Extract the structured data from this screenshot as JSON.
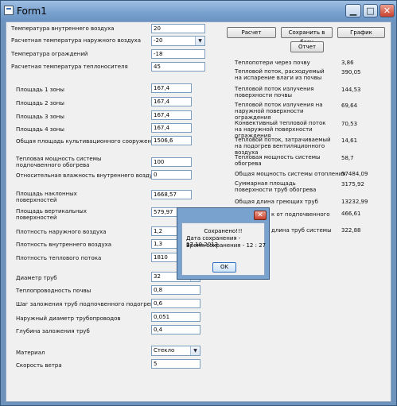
{
  "window": {
    "title": "Form1",
    "minimize_glyph": "▁",
    "maximize_glyph": "□",
    "close_glyph": "✕"
  },
  "toolbar": {
    "calc_label": "Расчет",
    "save_db_label": "Сохранить в базу",
    "graph_label": "График",
    "report_label": "Отчет"
  },
  "inputs": {
    "inner_temp": {
      "label": "Температура внутреннего воздуха",
      "value": "20"
    },
    "outer_temp": {
      "label": "Расчетная температура наружного воздуха",
      "value": "-20"
    },
    "envelope_temp": {
      "label": "Температура ограждений",
      "value": "-18"
    },
    "coolant_temp": {
      "label": "Расчетная температура теплоносителя",
      "value": "45"
    },
    "zone1": {
      "label": "Площадь 1 зоны",
      "value": "167,4"
    },
    "zone2": {
      "label": "Площадь 2 зоны",
      "value": "167,4"
    },
    "zone3": {
      "label": "Площадь 3 зоны",
      "value": "167,4"
    },
    "zone4": {
      "label": "Площадь 4 зоны",
      "value": "167,4"
    },
    "total_area": {
      "label": "Общая площадь культивационного сооружения",
      "value": "1506,6"
    },
    "heating_power": {
      "label": "Тепловая мощность системы подпочвенного обогрева",
      "value": "100"
    },
    "humidity": {
      "label": "Относительная влажность внутреннего воздуха",
      "value": "0"
    },
    "inclined_area": {
      "label": "Площадь наклонных поверхностей",
      "value": "1668,57"
    },
    "vertical_area": {
      "label": "Площадь вертикальных поверхностей",
      "value": "579,97"
    },
    "outer_density": {
      "label": "Плотность наружного воздуха",
      "value": "1,2"
    },
    "inner_density": {
      "label": "Плотность внутреннего воздуха",
      "value": "1,3"
    },
    "coolant_density": {
      "label": "Плотность теплового потока",
      "value": "1810"
    },
    "pipe_diameter": {
      "label": "Диаметр труб",
      "value": "32"
    },
    "soil_conductivity": {
      "label": "Теплопроводность почвы",
      "value": "0,8"
    },
    "pipe_step": {
      "label": "Шаг заложения труб подпочвенного подогрева",
      "value": "0,6"
    },
    "outer_diameter": {
      "label": "Наружный диаметр трубопроводов",
      "value": "0,051"
    },
    "pipe_depth": {
      "label": "Глубина заложения труб",
      "value": "0,4"
    },
    "material": {
      "label": "Материал",
      "value": "Стекло"
    },
    "wind_speed": {
      "label": "Скорость ветра",
      "value": "5"
    }
  },
  "results": [
    {
      "label": "Теплопотери через почву",
      "value": "3,86"
    },
    {
      "label": "Тепловой поток, расходуемый на испарение влаги из почвы",
      "value": "390,05"
    },
    {
      "label": "Тепловой поток излучения поверхности почвы",
      "value": "144,53"
    },
    {
      "label": "Тепловой поток излучения на наружной поверхности ограждения",
      "value": "69,64"
    },
    {
      "label": "Конвективный тепловой поток на наружной поверхности ограждения",
      "value": "70,53"
    },
    {
      "label": "Тепловой поток, затрачиваемый на подогрев вентиляционного воздуха",
      "value": "14,61"
    },
    {
      "label": "Тепловая мощность системы обогрева",
      "value": "58,7"
    },
    {
      "label": "Общая мощность системы отопления",
      "value": "57484,09"
    },
    {
      "label": "Суммарная площадь поверхности труб обогрева",
      "value": "3175,92"
    },
    {
      "label": "Общая длина греющих труб",
      "value": "13232,99"
    },
    {
      "label": "к от подпочвенного",
      "value": "466,61"
    },
    {
      "label": "длина труб системы",
      "value": "322,88"
    }
  ],
  "dialog": {
    "line1": "Сохранено!!!",
    "line2": "Дата сохранения - 17.10.2013",
    "line3": "Время сохранения - 12 : 27",
    "ok_label": "OK",
    "close_glyph": "✕"
  }
}
